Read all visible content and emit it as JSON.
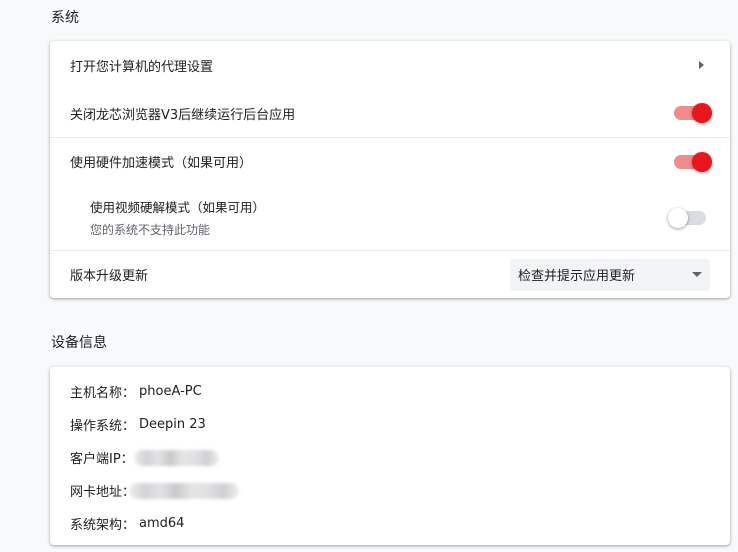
{
  "system": {
    "title": "系统",
    "proxy_label": "打开您计算机的代理设置",
    "background_label": "关闭龙芯浏览器V3后继续运行后台应用",
    "background_on": true,
    "hw_accel_label": "使用硬件加速模式（如果可用）",
    "hw_accel_on": true,
    "video_decode_label": "使用视频硬解模式（如果可用）",
    "video_decode_sub": "您的系统不支持此功能",
    "video_decode_on": false,
    "update_label": "版本升级更新",
    "update_value": "检查并提示应用更新"
  },
  "device": {
    "title": "设备信息",
    "host_key": "主机名称：",
    "host_value": "phoeA-PC",
    "os_key": "操作系统：",
    "os_value": "Deepin 23",
    "ip_key": "客户端IP：",
    "mac_key": "网卡地址：",
    "arch_key": "系统架构：",
    "arch_value": "amd64"
  },
  "colors": {
    "accent": "#e8161d",
    "accent_track": "#f28b8b"
  }
}
